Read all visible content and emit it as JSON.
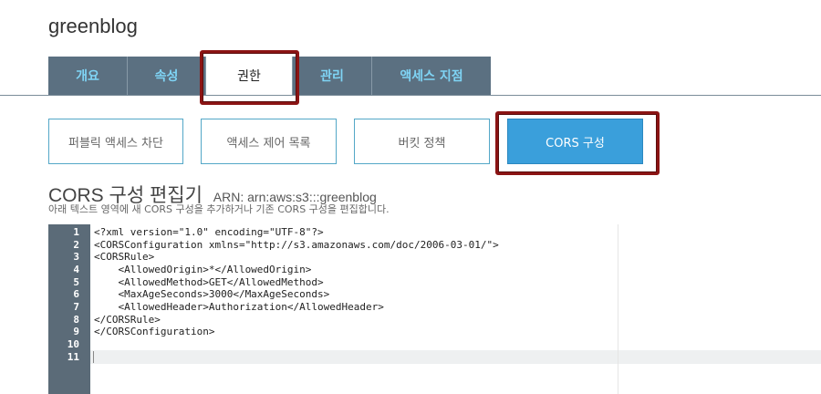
{
  "bucket": {
    "name": "greenblog"
  },
  "tabs": [
    {
      "label": "개요"
    },
    {
      "label": "속성"
    },
    {
      "label": "권한"
    },
    {
      "label": "관리"
    },
    {
      "label": "액세스 지점"
    }
  ],
  "permission_subnav": [
    {
      "label": "퍼블릭 액세스 차단"
    },
    {
      "label": "액세스 제어 목록"
    },
    {
      "label": "버킷 정책"
    },
    {
      "label": "CORS 구성"
    }
  ],
  "editor": {
    "title": "CORS 구성 편집기",
    "arn": "ARN: arn:aws:s3:::greenblog",
    "description": "아래 텍스트 영역에 새 CORS 구성을 추가하거나 기존 CORS 구성을 편집합니다.",
    "line_numbers": [
      "1",
      "2",
      "3",
      "4",
      "5",
      "6",
      "7",
      "8",
      "9",
      "10",
      "11"
    ],
    "lines": [
      "<?xml version=\"1.0\" encoding=\"UTF-8\"?>",
      "<CORSConfiguration xmlns=\"http://s3.amazonaws.com/doc/2006-03-01/\">",
      "<CORSRule>",
      "    <AllowedOrigin>*</AllowedOrigin>",
      "    <AllowedMethod>GET</AllowedMethod>",
      "    <MaxAgeSeconds>3000</MaxAgeSeconds>",
      "    <AllowedHeader>Authorization</AllowedHeader>",
      "</CORSRule>",
      "</CORSConfiguration>",
      "",
      ""
    ]
  },
  "colors": {
    "tab_bg": "#5b7081",
    "tab_text": "#7fd4f5",
    "active_button": "#3a9fdb",
    "highlight_border": "#8b1414",
    "gutter": "#5b6b78"
  }
}
